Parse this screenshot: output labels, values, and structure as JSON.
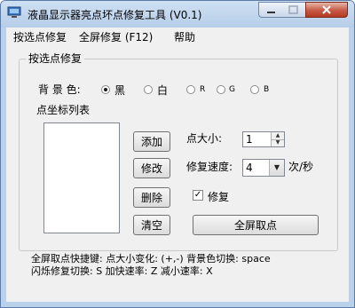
{
  "window": {
    "title": "液晶显示器亮点坏点修复工具 (V0.1)",
    "minimize_glyph": "─",
    "maximize_glyph": "☐",
    "close_glyph": "✕"
  },
  "menu": [
    "按选点修复",
    "全屏修复 (F12)",
    "帮助"
  ],
  "group": {
    "title": "按选点修复"
  },
  "bg": {
    "label": "背 景 色:",
    "options": [
      {
        "label": "黑",
        "selected": true
      },
      {
        "label": "白",
        "selected": false
      },
      {
        "label": "R",
        "selected": false
      },
      {
        "label": "G",
        "selected": false
      },
      {
        "label": "B",
        "selected": false
      }
    ]
  },
  "coords": {
    "label": "点坐标列表"
  },
  "buttons": {
    "add": "添加",
    "edit": "修改",
    "delete": "删除",
    "clear": "清空",
    "fullscreen": "全屏取点"
  },
  "point_size": {
    "label": "点大小:",
    "value": "1",
    "up": "▲",
    "down": "▼"
  },
  "speed": {
    "label": "修复速度:",
    "value": "4",
    "unit": "次/秒",
    "arrow": "▼"
  },
  "repair": {
    "label": "修复",
    "checked": true,
    "check_glyph": "✓"
  },
  "footer": {
    "line1": "全屏取点快捷键: 点大小变化: (+,-)  背景色切换: space",
    "line2": "闪烁修复切换: S 加快速率: Z 减小速率: X"
  },
  "colors": {
    "titlebar": "#b9d1ea",
    "close_button": "#c65a44",
    "panel": "#f0f0f0"
  },
  "icons": [
    "app-icon",
    "minimize-icon",
    "maximize-icon",
    "close-icon"
  ]
}
